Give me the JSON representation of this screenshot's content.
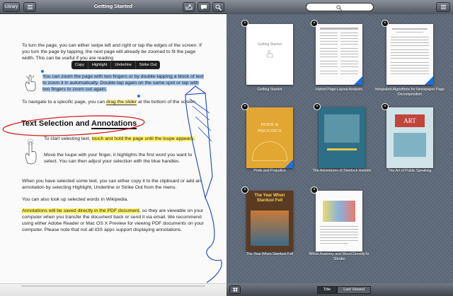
{
  "left": {
    "toolbar": {
      "library_label": "Library",
      "title": "Getting Started"
    },
    "menu": [
      "Copy",
      "Highlight",
      "Underline",
      "Strike Out"
    ],
    "paragraphs": {
      "p1": "To turn the page, you can either swipe left and right or tap the edges of the screen. If you turn the page by tapping, the next page will already be zoomed to fit the page width. This can be useful if you are reading",
      "p2a": "You can zoom the page with two fingers or by double-tapping a block of text to zoom it in automatically. Double-tap again on the same spot or tap with two fingers to zoom out again.",
      "p3a": "To navigate to a specific page, you can ",
      "p3b": "drag the slider",
      "p3c": " at the bottom of the screen.",
      "heading_a": "Text Selection and ",
      "heading_b": "Annotations",
      "p4a": "To start selecting text, ",
      "p4b": "touch and hold the page until the loupe appears.",
      "p5": "Move the loupe with your finger, it highlights the first word you want to select. You can then adjust your selection with the blue handles.",
      "p6": "When you have selected some text, you can either copy it to the clipboard or add an annotation by selecting Highlight, Underline or Strike Out from the menu.",
      "p7": "You can also look up selected words in Wikipedia.",
      "p8a": "Annotations will be saved directly in the PDF document",
      "p8b": ", so they are viewable on your computer when you transfer the document back or send it via email. We recommend using either Adobe Reader or Mac OS X Preview for viewing PDF documents on your computer. Please note that not all iOS apps support displaying annotations."
    }
  },
  "right": {
    "books": [
      {
        "title": "Getting Started",
        "cover_text": "Getting Started"
      },
      {
        "title": "Hybrid Page Layout Analysis"
      },
      {
        "title": "Integrated Algorithms for Newspaper Page Decomposition"
      },
      {
        "title": "Pride and Prejudice",
        "cover_text": "PRIDE & PREJUDICE"
      },
      {
        "title": "The Adventures of Sherlock Holmes"
      },
      {
        "title": "The Art of Public Speaking",
        "cover_text": "ART"
      },
      {
        "title": "The Year When Stardust Fell",
        "cover_text": "The Year When Stardust Fell"
      },
      {
        "title": "Wood Anatomy and Wood Density In Shrubs"
      }
    ],
    "tabs": {
      "title": "Title",
      "last_viewed": "Last Viewed"
    }
  },
  "colors": {
    "highlight": "#fff25e",
    "selection": "#a7c8ee",
    "ink": "#1844c8",
    "red_ink": "#d42020"
  }
}
